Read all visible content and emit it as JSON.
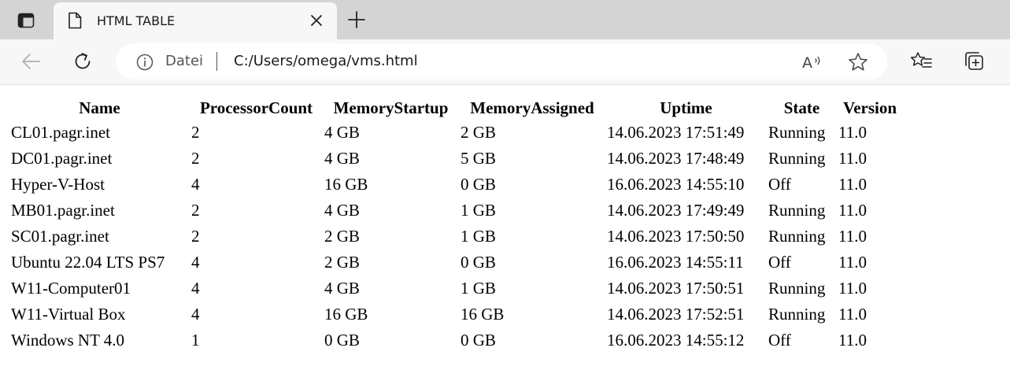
{
  "browser": {
    "tab": {
      "title": "HTML TABLE"
    },
    "address_bar": {
      "scheme_label": "Datei",
      "url": "C:/Users/omega/vms.html"
    },
    "icons": [
      "tab-actions-icon",
      "file-icon",
      "close-icon",
      "new-tab-icon",
      "back-icon",
      "refresh-icon",
      "info-icon",
      "read-aloud-icon",
      "favorite-star-icon",
      "favorites-icon",
      "collections-icon"
    ]
  },
  "table": {
    "headers": [
      "Name",
      "ProcessorCount",
      "MemoryStartup",
      "MemoryAssigned",
      "Uptime",
      "State",
      "Version"
    ],
    "rows": [
      [
        "CL01.pagr.inet",
        "2",
        "4 GB",
        "2 GB",
        "14.06.2023 17:51:49",
        "Running",
        "11.0"
      ],
      [
        "DC01.pagr.inet",
        "2",
        "4 GB",
        "5 GB",
        "14.06.2023 17:48:49",
        "Running",
        "11.0"
      ],
      [
        "Hyper-V-Host",
        "4",
        "16 GB",
        "0 GB",
        "16.06.2023 14:55:10",
        "Off",
        "11.0"
      ],
      [
        "MB01.pagr.inet",
        "2",
        "4 GB",
        "1 GB",
        "14.06.2023 17:49:49",
        "Running",
        "11.0"
      ],
      [
        "SC01.pagr.inet",
        "2",
        "2 GB",
        "1 GB",
        "14.06.2023 17:50:50",
        "Running",
        "11.0"
      ],
      [
        "Ubuntu 22.04 LTS PS7",
        "4",
        "2 GB",
        "0 GB",
        "16.06.2023 14:55:11",
        "Off",
        "11.0"
      ],
      [
        "W11-Computer01",
        "4",
        "4 GB",
        "1 GB",
        "14.06.2023 17:50:51",
        "Running",
        "11.0"
      ],
      [
        "W11-Virtual Box",
        "4",
        "16 GB",
        "16 GB",
        "14.06.2023 17:52:51",
        "Running",
        "11.0"
      ],
      [
        "Windows NT 4.0",
        "1",
        "0 GB",
        "0 GB",
        "16.06.2023 14:55:12",
        "Off",
        "11.0"
      ]
    ]
  }
}
